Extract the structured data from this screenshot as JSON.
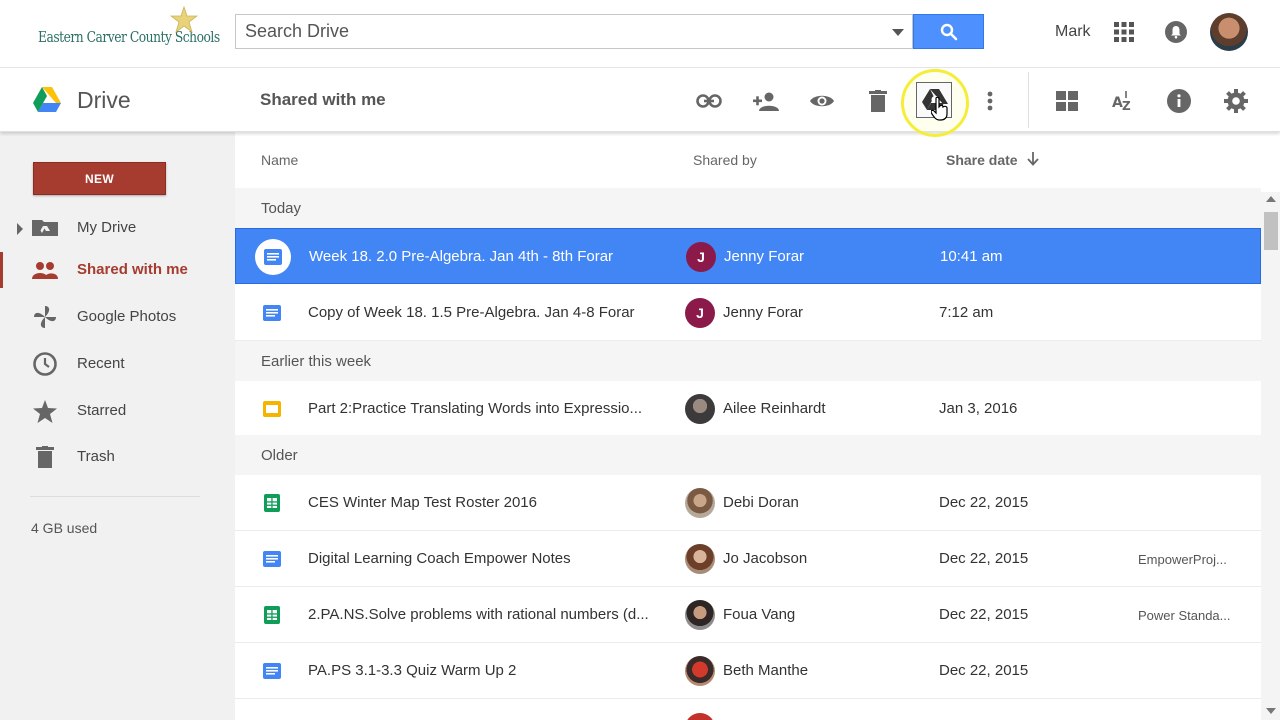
{
  "header": {
    "org_name": "Eastern Carver County Schools",
    "search_placeholder": "Search Drive",
    "user_name": "Mark",
    "icons": [
      "search-icon",
      "apps-grid-icon",
      "notifications-icon",
      "account-avatar"
    ]
  },
  "toolbar": {
    "app_name": "Drive",
    "location": "Shared with me",
    "actions": [
      "link-icon",
      "add-person-icon",
      "preview-eye-icon",
      "trash-icon",
      "add-to-drive-icon",
      "more-vert-icon",
      "grid-view-icon",
      "sort-az-icon",
      "info-icon",
      "settings-gear-icon"
    ]
  },
  "sidebar": {
    "new_label": "NEW",
    "items": [
      {
        "label": "My Drive",
        "icon": "folder-drive-icon"
      },
      {
        "label": "Shared with me",
        "icon": "people-icon"
      },
      {
        "label": "Google Photos",
        "icon": "pinwheel-photos-icon"
      },
      {
        "label": "Recent",
        "icon": "clock-icon"
      },
      {
        "label": "Starred",
        "icon": "star-icon"
      },
      {
        "label": "Trash",
        "icon": "trash-icon"
      }
    ],
    "storage": "4 GB used"
  },
  "columns": {
    "name": "Name",
    "shared_by": "Shared by",
    "share_date": "Share date"
  },
  "groups": {
    "today": "Today",
    "earlier": "Earlier this week",
    "older": "Older"
  },
  "files": [
    {
      "name": "Week 18. 2.0 Pre-Algebra. Jan 4th - 8th Forar",
      "type": "doc",
      "sharer": "Jenny Forar",
      "initial": "J",
      "date": "10:41 am",
      "location": ""
    },
    {
      "name": "Copy of Week 18. 1.5 Pre-Algebra. Jan 4-8 Forar",
      "type": "doc",
      "sharer": "Jenny Forar",
      "initial": "J",
      "date": "7:12 am",
      "location": ""
    },
    {
      "name": "Part 2:Practice Translating Words into Expressio...",
      "type": "slides",
      "sharer": "Ailee Reinhardt",
      "initial": "",
      "date": "Jan 3, 2016",
      "location": ""
    },
    {
      "name": "CES Winter Map Test Roster 2016",
      "type": "sheet",
      "sharer": "Debi Doran",
      "initial": "",
      "date": "Dec 22, 2015",
      "location": ""
    },
    {
      "name": "Digital Learning Coach Empower Notes",
      "type": "doc",
      "sharer": "Jo Jacobson",
      "initial": "",
      "date": "Dec 22, 2015",
      "location": "EmpowerProj..."
    },
    {
      "name": "2.PA.NS.Solve problems with rational numbers (d...",
      "type": "sheet",
      "sharer": "Foua Vang",
      "initial": "",
      "date": "Dec 22, 2015",
      "location": "Power Standa..."
    },
    {
      "name": "PA.PS 3.1-3.3 Quiz Warm Up 2",
      "type": "doc",
      "sharer": "Beth Manthe",
      "initial": "",
      "date": "Dec 22, 2015",
      "location": ""
    }
  ],
  "colors": {
    "accent_red": "#a53c2f",
    "selection_blue": "#4285f4",
    "search_blue": "#4d90fe",
    "jenny_avatar": "#8b1a4a"
  }
}
